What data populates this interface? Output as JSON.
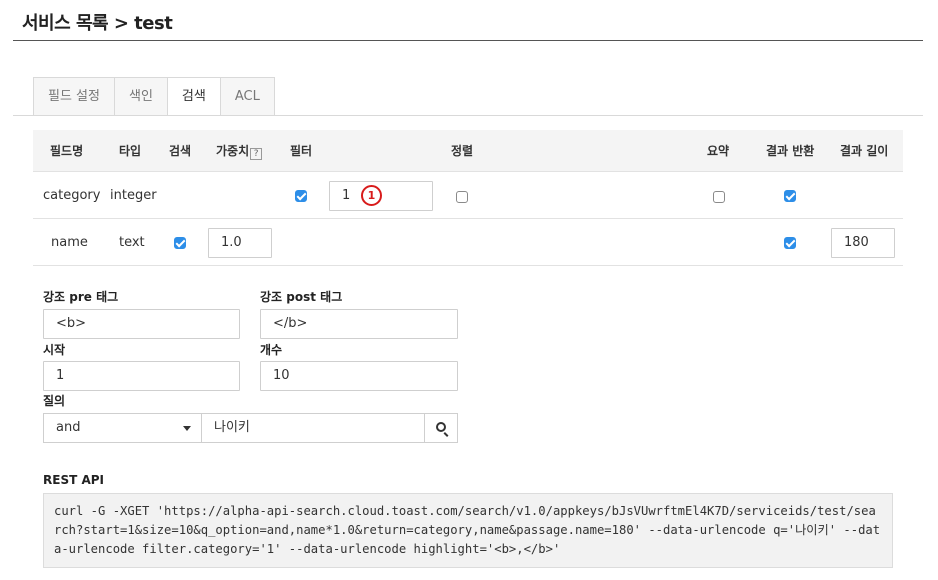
{
  "header": {
    "title": "서비스 목록 > test"
  },
  "tabs": [
    {
      "label": "필드 설정",
      "active": false
    },
    {
      "label": "색인",
      "active": false
    },
    {
      "label": "검색",
      "active": true
    },
    {
      "label": "ACL",
      "active": false
    }
  ],
  "grid": {
    "headers": {
      "field_name": "필드명",
      "type": "타입",
      "search": "검색",
      "weight": "가중치",
      "weight_help": "?",
      "filter": "필터",
      "sort": "정렬",
      "summary": "요약",
      "return_result": "결과 반환",
      "result_length": "결과 길이"
    },
    "rows": [
      {
        "field_name": "category",
        "type": "integer",
        "filter_checked": true,
        "filter_value": "1",
        "filter_marker": "1",
        "sort_checked": false,
        "summary_checked": false,
        "return_checked": true
      },
      {
        "field_name": "name",
        "type": "text",
        "search_checked": true,
        "weight_value": "1.0",
        "return_checked": true,
        "result_length": "180"
      }
    ]
  },
  "form": {
    "highlight_pre": {
      "label": "강조 pre 태그",
      "value": "<b>"
    },
    "highlight_post": {
      "label": "강조 post 태그",
      "value": "</b>"
    },
    "start": {
      "label": "시작",
      "value": "1"
    },
    "count": {
      "label": "개수",
      "value": "10"
    },
    "query": {
      "label": "질의",
      "operator": "and",
      "value": "나이키"
    }
  },
  "rest_api": {
    "label": "REST API",
    "command": "curl -G -XGET 'https://alpha-api-search.cloud.toast.com/search/v1.0/appkeys/bJsVUwrftmEl4K7D/serviceids/test/search?start=1&size=10&q_option=and,name*1.0&return=category,name&passage.name=180' --data-urlencode q='나이키' --data-urlencode filter.category='1' --data-urlencode highlight='<b>,</b>'"
  },
  "colors": {
    "checkbox_accent": "#2d8ee8",
    "marker": "#d81b1b"
  },
  "icons": {
    "search_button": "search-icon",
    "select_caret": "caret-down-icon"
  }
}
